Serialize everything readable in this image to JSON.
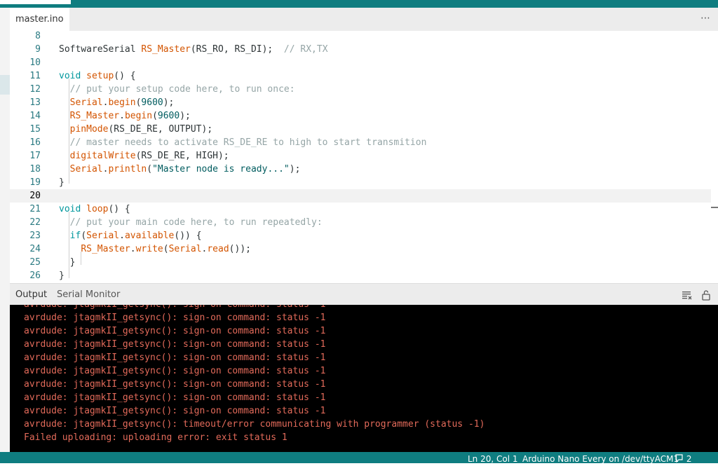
{
  "tab": {
    "filename": "master.ino",
    "more": "⋯"
  },
  "editor": {
    "lines": [
      {
        "n": "8",
        "parts": []
      },
      {
        "n": "9",
        "parts": [
          [
            "",
            "SoftwareSerial "
          ],
          [
            "fn",
            "RS_Master"
          ],
          [
            "",
            "(RS_RO, RS_DI);  "
          ],
          [
            "cm",
            "// RX,TX"
          ]
        ]
      },
      {
        "n": "10",
        "parts": []
      },
      {
        "n": "11",
        "parts": [
          [
            "kw",
            "void "
          ],
          [
            "fn",
            "setup"
          ],
          [
            "",
            "() {"
          ]
        ]
      },
      {
        "n": "12",
        "parts": [
          [
            "",
            "  "
          ],
          [
            "cm",
            "// put your setup code here, to run once:"
          ]
        ]
      },
      {
        "n": "13",
        "parts": [
          [
            "",
            "  "
          ],
          [
            "fn",
            "Serial"
          ],
          [
            "",
            "."
          ],
          [
            "fn",
            "begin"
          ],
          [
            "",
            "("
          ],
          [
            "num",
            "9600"
          ],
          [
            "",
            ");"
          ]
        ]
      },
      {
        "n": "14",
        "parts": [
          [
            "",
            "  "
          ],
          [
            "fn",
            "RS_Master"
          ],
          [
            "",
            "."
          ],
          [
            "fn",
            "begin"
          ],
          [
            "",
            "("
          ],
          [
            "num",
            "9600"
          ],
          [
            "",
            ");"
          ]
        ]
      },
      {
        "n": "15",
        "parts": [
          [
            "",
            "  "
          ],
          [
            "fn",
            "pinMode"
          ],
          [
            "",
            "(RS_DE_RE, OUTPUT);"
          ]
        ]
      },
      {
        "n": "16",
        "parts": [
          [
            "",
            "  "
          ],
          [
            "cm",
            "// master needs to activate RS_DE_RE to high to start transmition"
          ]
        ]
      },
      {
        "n": "17",
        "parts": [
          [
            "",
            "  "
          ],
          [
            "fn",
            "digitalWrite"
          ],
          [
            "",
            "(RS_DE_RE, HIGH);"
          ]
        ]
      },
      {
        "n": "18",
        "parts": [
          [
            "",
            "  "
          ],
          [
            "fn",
            "Serial"
          ],
          [
            "",
            "."
          ],
          [
            "fn",
            "println"
          ],
          [
            "",
            "("
          ],
          [
            "str",
            "\"Master node is ready...\""
          ],
          [
            "",
            ");"
          ]
        ]
      },
      {
        "n": "19",
        "parts": [
          [
            "",
            "}"
          ]
        ]
      },
      {
        "n": "20",
        "parts": [],
        "active": true
      },
      {
        "n": "21",
        "parts": [
          [
            "kw",
            "void "
          ],
          [
            "fn",
            "loop"
          ],
          [
            "",
            "() {"
          ]
        ]
      },
      {
        "n": "22",
        "parts": [
          [
            "",
            "  "
          ],
          [
            "cm",
            "// put your main code here, to run repeatedly:"
          ]
        ]
      },
      {
        "n": "23",
        "parts": [
          [
            "",
            "  "
          ],
          [
            "kw",
            "if"
          ],
          [
            "",
            "("
          ],
          [
            "fn",
            "Serial"
          ],
          [
            "",
            "."
          ],
          [
            "fn",
            "available"
          ],
          [
            "",
            "()) {"
          ]
        ]
      },
      {
        "n": "24",
        "parts": [
          [
            "",
            "    "
          ],
          [
            "fn",
            "RS_Master"
          ],
          [
            "",
            "."
          ],
          [
            "fn",
            "write"
          ],
          [
            "",
            "("
          ],
          [
            "fn",
            "Serial"
          ],
          [
            "",
            "."
          ],
          [
            "fn",
            "read"
          ],
          [
            "",
            "());"
          ]
        ]
      },
      {
        "n": "25",
        "parts": [
          [
            "",
            "  }"
          ]
        ]
      },
      {
        "n": "26",
        "parts": [
          [
            "",
            "}"
          ]
        ]
      }
    ]
  },
  "output_panel": {
    "tabs": [
      "Output",
      "Serial Monitor"
    ],
    "clear_icon": "clear-output-icon",
    "lock_icon": "lock-scroll-icon"
  },
  "console": {
    "lines": [
      "avrdude: jtagmkII_getsync(): sign-on command: status -1",
      "avrdude: jtagmkII_getsync(): sign-on command: status -1",
      "avrdude: jtagmkII_getsync(): sign-on command: status -1",
      "avrdude: jtagmkII_getsync(): sign-on command: status -1",
      "avrdude: jtagmkII_getsync(): sign-on command: status -1",
      "avrdude: jtagmkII_getsync(): sign-on command: status -1",
      "avrdude: jtagmkII_getsync(): sign-on command: status -1",
      "avrdude: jtagmkII_getsync(): sign-on command: status -1",
      "avrdude: jtagmkII_getsync(): sign-on command: status -1",
      "avrdude: jtagmkII_getsync(): timeout/error communicating with programmer (status -1)",
      "Failed uploading: uploading error: exit status 1"
    ]
  },
  "statusbar": {
    "position": "Ln 20, Col 1",
    "board": "Arduino Nano Every on /dev/ttyACM1",
    "notifications": "2"
  },
  "colors": {
    "accent": "#0f7d80",
    "console_text": "#e26a5a",
    "keyword": "#00979d",
    "function": "#d35400"
  }
}
